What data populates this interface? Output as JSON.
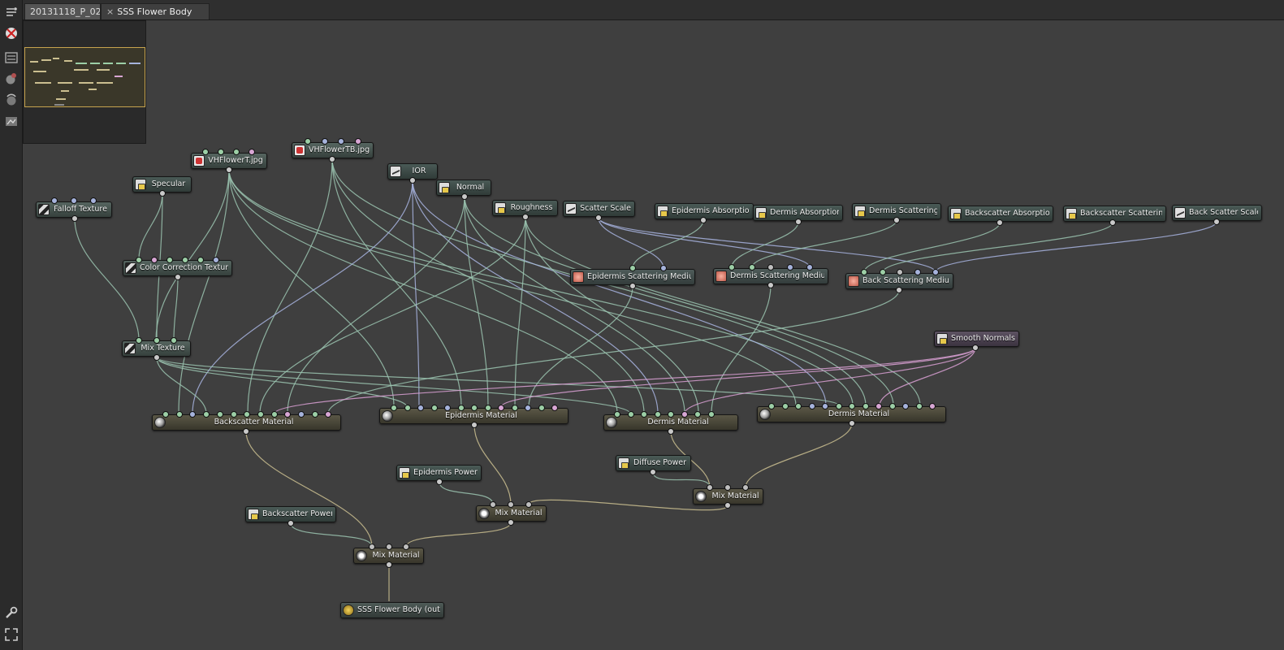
{
  "tabs": [
    {
      "label": "20131118_P_02"
    },
    {
      "label": "SSS Flower Body",
      "close_glyph": "×"
    }
  ],
  "toolbar": {
    "icons": [
      "graph-layout-icon",
      "disconnect-icon",
      "node-list-icon",
      "material-ball-icon",
      "refresh-material-icon",
      "render-icon",
      "wrench-icon",
      "fullscreen-icon"
    ]
  },
  "colors": {
    "wire_default": "#9bc4b0",
    "wire_blue": "#a8b4e0",
    "wire_pink": "#d9a0d4",
    "wire_material": "#cbbf90",
    "minimap_frame": "#c6a34e"
  },
  "nodes": {
    "falloff_texture": {
      "label": "Falloff Texture"
    },
    "specular": {
      "label": "Specular"
    },
    "vhflowert": {
      "label": "VHFlowerT.jpg"
    },
    "vhflowertb": {
      "label": "VHFlowerTB.jpg"
    },
    "ior": {
      "label": "IOR"
    },
    "normal": {
      "label": "Normal"
    },
    "roughness": {
      "label": "Roughness"
    },
    "scatter_scale": {
      "label": "Scatter Scale"
    },
    "epidermis_absorption": {
      "label": "Epidermis Absorption"
    },
    "dermis_absorption": {
      "label": "Dermis Absorption"
    },
    "dermis_scattering": {
      "label": "Dermis Scattering"
    },
    "backscatter_absorption": {
      "label": "Backscatter Absorption"
    },
    "backscatter_scattering": {
      "label": "Backscatter Scattering"
    },
    "back_scatter_scale": {
      "label": "Back Scatter Scale"
    },
    "color_correction": {
      "label": "Color Correction Texture"
    },
    "epidermis_medium": {
      "label": "Epidermis Scattering Medium"
    },
    "dermis_medium": {
      "label": "Dermis Scattering Medium"
    },
    "back_medium": {
      "label": "Back Scattering Medium"
    },
    "smooth_normals": {
      "label": "Smooth Normals"
    },
    "mix_texture": {
      "label": "Mix Texture"
    },
    "backscatter_material": {
      "label": "Backscatter Material"
    },
    "epidermis_material": {
      "label": "Epidermis Material"
    },
    "dermis_material_1": {
      "label": "Dermis Material"
    },
    "dermis_material_2": {
      "label": "Dermis Material"
    },
    "diffuse_power": {
      "label": "Diffuse Power"
    },
    "epidermis_power": {
      "label": "Epidermis Power"
    },
    "mix_material_right": {
      "label": "Mix Material"
    },
    "mix_material_mid": {
      "label": "Mix Material"
    },
    "backscatter_power": {
      "label": "Backscatter Power"
    },
    "mix_material_final": {
      "label": "Mix Material"
    },
    "output": {
      "label": "SSS Flower Body (out)"
    }
  }
}
